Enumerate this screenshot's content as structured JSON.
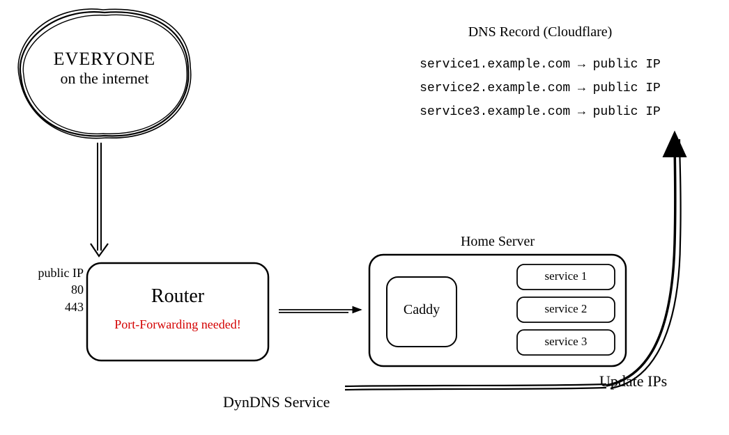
{
  "cloud": {
    "line1": "EVERYONE",
    "line2": "on the internet"
  },
  "dns": {
    "heading": "DNS Record (Cloudflare)",
    "records": [
      "service1.example.com → public IP",
      "service2.example.com → public IP",
      "service3.example.com → public IP"
    ]
  },
  "router": {
    "title": "Router",
    "note": "Port-Forwarding needed!",
    "iplabel": "public IP",
    "port1": "80",
    "port2": "443"
  },
  "server": {
    "title": "Home Server",
    "proxy": "Caddy",
    "services": [
      "service 1",
      "service 2",
      "service 3"
    ]
  },
  "dyndns": {
    "label": "DynDNS Service",
    "update": "Update IPs"
  }
}
